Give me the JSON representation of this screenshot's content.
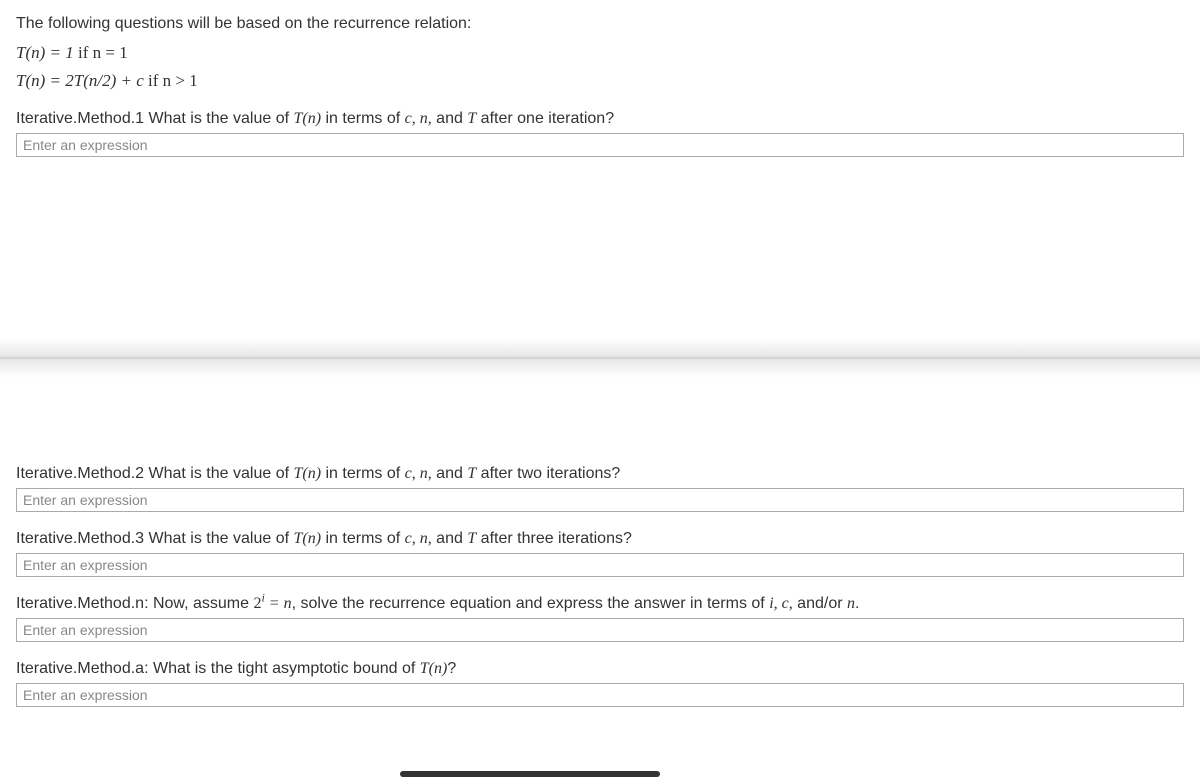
{
  "intro": "The following questions will be based on the recurrence relation:",
  "eq1_left": "T(n) = 1",
  "eq1_cond": " if n = 1",
  "eq2_left": "T(n) = 2T(n/2) + c",
  "eq2_cond": " if n > 1",
  "q1": {
    "label": "Iterative.Method.1 What is the value of ",
    "tn": "T(n)",
    "mid": " in terms of ",
    "vars": "c, n,",
    "and": " and ",
    "tvar": "T",
    "tail": " after one iteration?",
    "placeholder": "Enter an expression"
  },
  "q2": {
    "label": "Iterative.Method.2 What is the value of ",
    "tn": "T(n)",
    "mid": " in terms of ",
    "vars": "c, n,",
    "and": " and ",
    "tvar": "T",
    "tail": " after two iterations?",
    "placeholder": "Enter an expression"
  },
  "q3": {
    "label": "Iterative.Method.3 What is the value of ",
    "tn": "T(n)",
    "mid": " in terms of ",
    "vars": "c, n,",
    "and": " and ",
    "tvar": "T",
    "tail": " after three iterations?",
    "placeholder": "Enter an expression"
  },
  "qn": {
    "label": "Iterative.Method.n: Now, assume ",
    "expr_base": "2",
    "expr_sup": "i",
    "eq": " = n",
    "mid": ", solve the recurrence equation and express the answer in terms of ",
    "vars": "i, c,",
    "andor": " and/or ",
    "nvar": "n",
    "period": ".",
    "placeholder": "Enter an expression"
  },
  "qa": {
    "label": "Iterative.Method.a: What is the tight asymptotic bound of ",
    "tn": "T(n)",
    "q": "?",
    "placeholder": "Enter an expression"
  }
}
